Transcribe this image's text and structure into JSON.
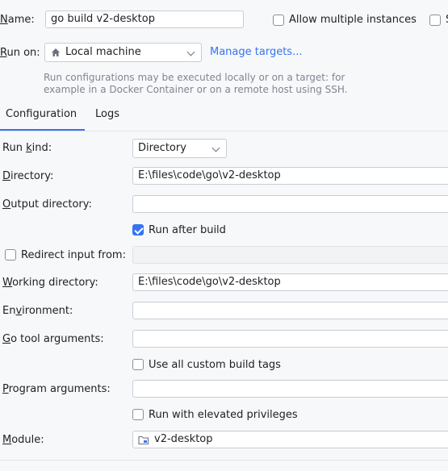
{
  "header": {
    "name_label_pre": "",
    "name_label_u": "N",
    "name_label_post": "ame:",
    "name_value": "go build v2-desktop",
    "allow_multiple_label": "Allow multiple instances",
    "store_checkbox_partial": "S",
    "run_on_label_pre": "",
    "run_on_label_u": "R",
    "run_on_label_post": "un on:",
    "run_on_value": "Local machine",
    "manage_targets": "Manage targets...",
    "hint_line1": "Run configurations may be executed locally or on a target: for",
    "hint_line2": "example in a Docker Container or on a remote host using SSH."
  },
  "tabs": [
    {
      "label": "Configuration",
      "active": true
    },
    {
      "label": "Logs",
      "active": false
    }
  ],
  "form": {
    "run_kind_pre": "Run ",
    "run_kind_u": "k",
    "run_kind_post": "ind:",
    "run_kind_value": "Directory",
    "directory_u": "D",
    "directory_post": "irectory:",
    "directory_value": "E:\\files\\code\\go\\v2-desktop",
    "output_u": "O",
    "output_post": "utput directory:",
    "output_value": "",
    "run_after_build": "Run after build",
    "run_after_build_checked": true,
    "redirect_label": "Redirect input from:",
    "redirect_checked": false,
    "working_u": "W",
    "working_post": "orking directory:",
    "working_value": "E:\\files\\code\\go\\v2-desktop",
    "env_pre": "En",
    "env_u": "v",
    "env_post": "ironment:",
    "env_value": "",
    "gotool_u": "G",
    "gotool_post": "o tool arguments:",
    "gotool_value": "",
    "custom_tags": "Use all custom build tags",
    "custom_tags_checked": false,
    "program_u": "P",
    "program_post": "rogram arguments:",
    "program_value": "",
    "elevated": "Run with elevated privileges",
    "elevated_checked": false,
    "module_u": "M",
    "module_post": "odule:",
    "module_value": "v2-desktop"
  },
  "colors": {
    "accent": "#3574f0",
    "background": "#f7f8fa"
  }
}
